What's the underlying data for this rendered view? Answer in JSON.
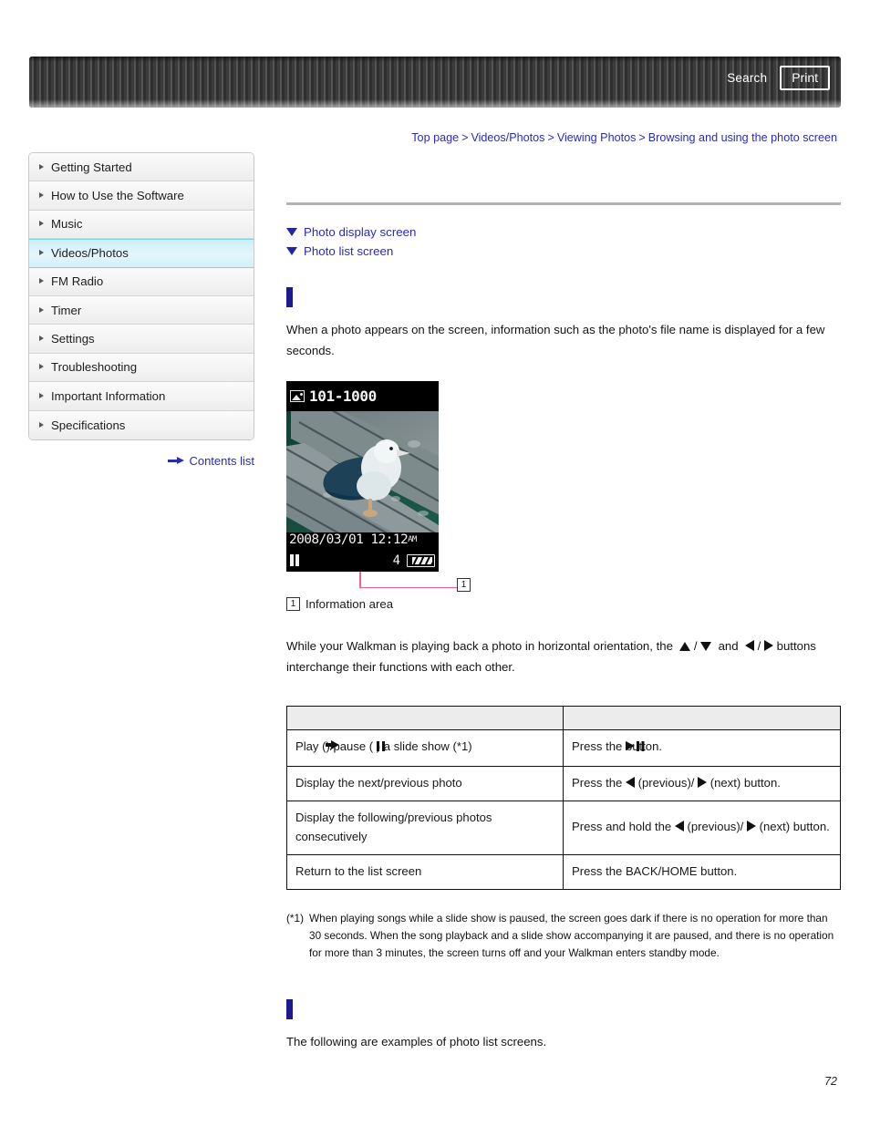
{
  "header": {
    "search_label": "Search",
    "print_label": "Print"
  },
  "breadcrumb": {
    "items": [
      {
        "label": "Top page"
      },
      {
        "label": "Videos/Photos"
      },
      {
        "label": "Viewing Photos"
      },
      {
        "label": "Browsing and using the photo screen"
      }
    ],
    "separator": ">"
  },
  "sidebar": {
    "items": [
      {
        "label": "Getting Started",
        "active": false
      },
      {
        "label": "How to Use the Software",
        "active": false
      },
      {
        "label": "Music",
        "active": false
      },
      {
        "label": "Videos/Photos",
        "active": true
      },
      {
        "label": "FM Radio",
        "active": false
      },
      {
        "label": "Timer",
        "active": false
      },
      {
        "label": "Settings",
        "active": false
      },
      {
        "label": "Troubleshooting",
        "active": false
      },
      {
        "label": "Important Information",
        "active": false
      },
      {
        "label": "Specifications",
        "active": false
      }
    ],
    "contents_list_label": "Contents list",
    "highlight_color": "#cdeef8"
  },
  "main": {
    "anchors": [
      {
        "label": "Photo display screen"
      },
      {
        "label": "Photo list screen"
      }
    ],
    "section_display": {
      "title": "",
      "bar_color": "#1b1b8f",
      "intro": "When a photo appears on the screen, information such as the photo's file name is displayed for a few seconds.",
      "orientation_note_before": "While your Walkman is playing back a photo in horizontal orientation, the",
      "orientation_note_mid": "and",
      "orientation_note_after": "buttons interchange their functions with each other."
    },
    "device_screenshot": {
      "file_label": "101-1000",
      "datetime": "2008/03/01 12:12",
      "ampm": "AM",
      "photo_count": "4",
      "photo_alt": "seagull standing on a wooden dock",
      "callout_number": "1"
    },
    "caption": {
      "number": "1",
      "text": "Information area"
    },
    "table": {
      "headers": [
        "",
        ""
      ],
      "rows": [
        {
          "action_prefix": "Play (",
          "action_mid": ")/pause (",
          "action_suffix": ") a slide show (*1)",
          "result_prefix": "Press the",
          "result_suffix": "button."
        },
        {
          "action": "Display the next/previous photo",
          "result_prefix": "Press the",
          "result_prev": "(previous)/",
          "result_next": "(next) button."
        },
        {
          "action": "Display the following/previous photos consecutively",
          "result_prefix": "Press and hold the",
          "result_prev": "(previous)/",
          "result_next": "(next) button."
        },
        {
          "action": "Return to the list screen",
          "result": "Press the BACK/HOME button."
        }
      ]
    },
    "footnote": {
      "mark": "(*1)",
      "text": "When playing songs while a slide show is paused, the screen goes dark if there is no operation for more than 30 seconds. When the song playback and a slide show accompanying it are paused, and there is no operation for more than 3 minutes, the screen turns off and your Walkman enters standby mode."
    },
    "section_list": {
      "title": "",
      "bar_color": "#1b1b8f",
      "intro": "The following are examples of photo list screens."
    }
  },
  "footer": {
    "page_number": "72"
  }
}
